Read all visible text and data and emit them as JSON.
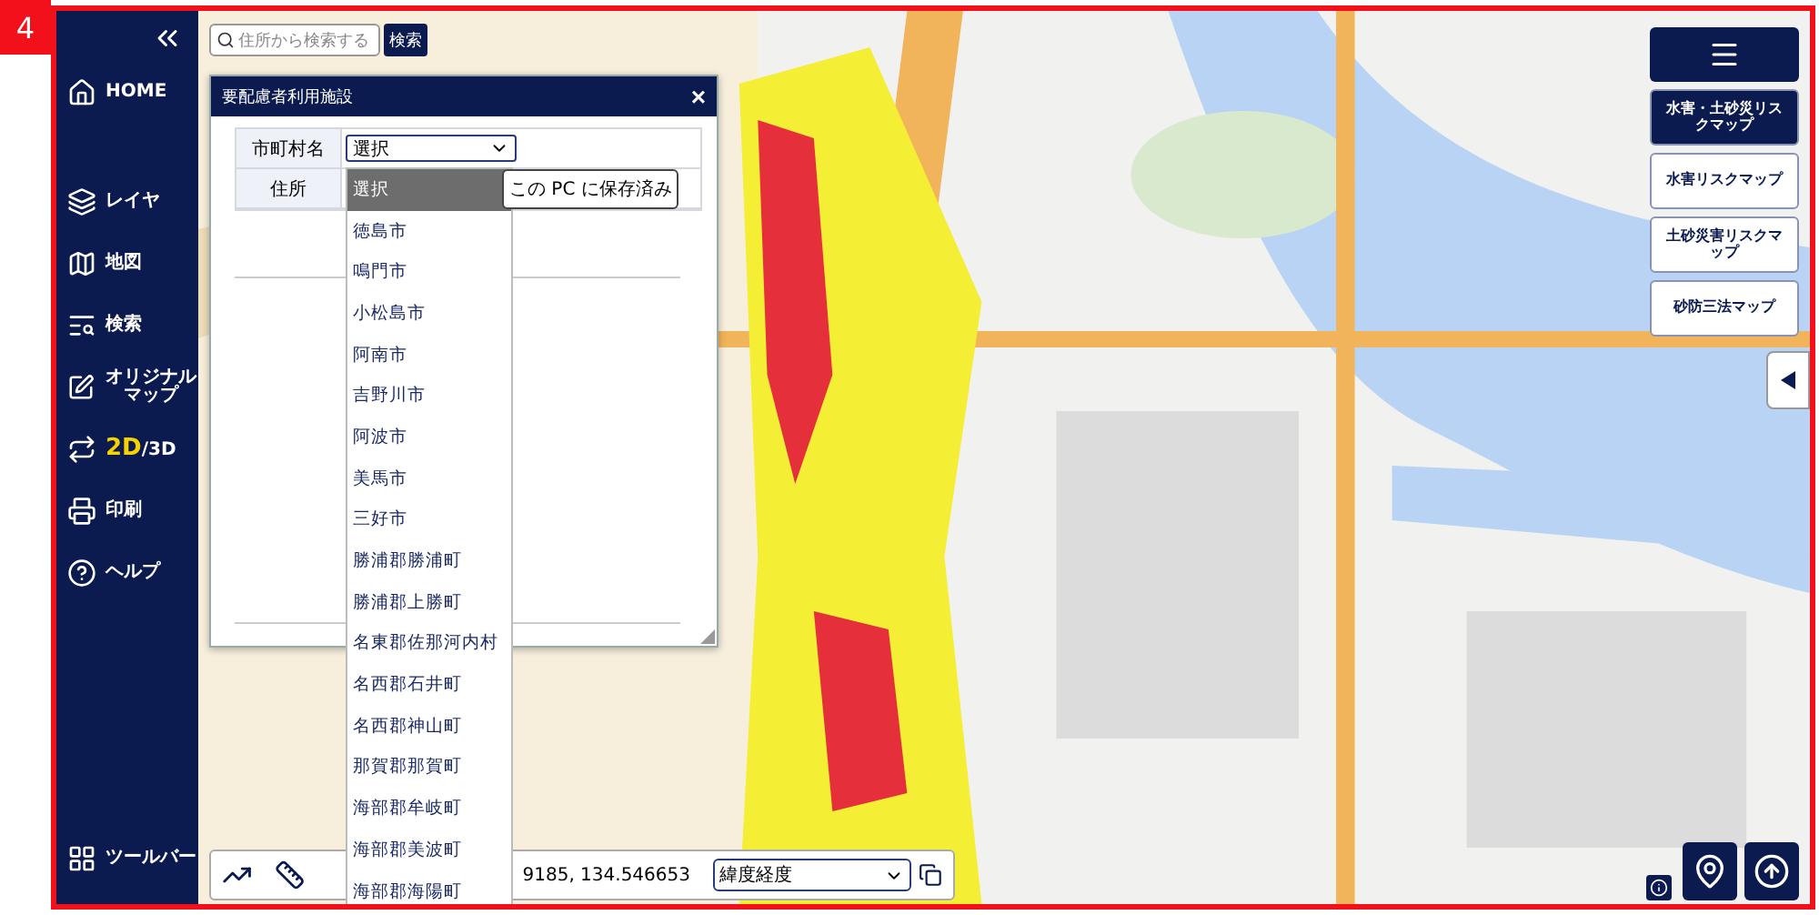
{
  "badge": "4",
  "search": {
    "placeholder": "住所から検索する",
    "button": "検索"
  },
  "sidebar": {
    "top_items": [
      {
        "label": "HOME"
      }
    ],
    "items": [
      {
        "kind": "link",
        "label": "レイヤ"
      },
      {
        "kind": "link",
        "label": "地図"
      },
      {
        "kind": "link",
        "label": "検索"
      },
      {
        "kind": "link",
        "label": "オリジナルマップ"
      },
      {
        "kind": "toggle",
        "options": [
          {
            "label": "2D",
            "selected": true
          },
          {
            "label": "/3D",
            "selected": false
          }
        ]
      },
      {
        "kind": "link",
        "label": "印刷"
      },
      {
        "kind": "link",
        "label": "ヘルプ"
      }
    ],
    "bottom_items": [
      {
        "label": "ツールバー"
      }
    ]
  },
  "dialog": {
    "title": "要配慮者利用施設",
    "close": "×",
    "fields": [
      {
        "label": "市町村名",
        "value": "選択"
      },
      {
        "label": "住所"
      }
    ],
    "dropdown": [
      {
        "label": "選択",
        "selected": true
      },
      {
        "label": "徳島市",
        "selected": false
      },
      {
        "label": "鳴門市",
        "selected": false
      },
      {
        "label": "小松島市",
        "selected": false
      },
      {
        "label": "阿南市",
        "selected": false
      },
      {
        "label": "吉野川市",
        "selected": false
      },
      {
        "label": "阿波市",
        "selected": false
      },
      {
        "label": "美馬市",
        "selected": false
      },
      {
        "label": "三好市",
        "selected": false
      },
      {
        "label": "勝浦郡勝浦町",
        "selected": false
      },
      {
        "label": "勝浦郡上勝町",
        "selected": false
      },
      {
        "label": "名東郡佐那河内村",
        "selected": false
      },
      {
        "label": "名西郡石井町",
        "selected": false
      },
      {
        "label": "名西郡神山町",
        "selected": false
      },
      {
        "label": "那賀郡那賀町",
        "selected": false
      },
      {
        "label": "海部郡牟岐町",
        "selected": false
      },
      {
        "label": "海部郡美波町",
        "selected": false
      },
      {
        "label": "海部郡海陽町",
        "selected": false
      }
    ],
    "tooltip": "この PC に保存済み"
  },
  "map_types": [
    {
      "label": "水害・土砂災リスクマップ",
      "selected": true
    },
    {
      "label": "水害リスクマップ",
      "selected": false
    },
    {
      "label": "土砂災害リスクマップ",
      "selected": false
    },
    {
      "label": "砂防三法マップ",
      "selected": false
    }
  ],
  "toolbar": {
    "coordinates": "9185, 134.546653",
    "format": "緯度経度"
  }
}
